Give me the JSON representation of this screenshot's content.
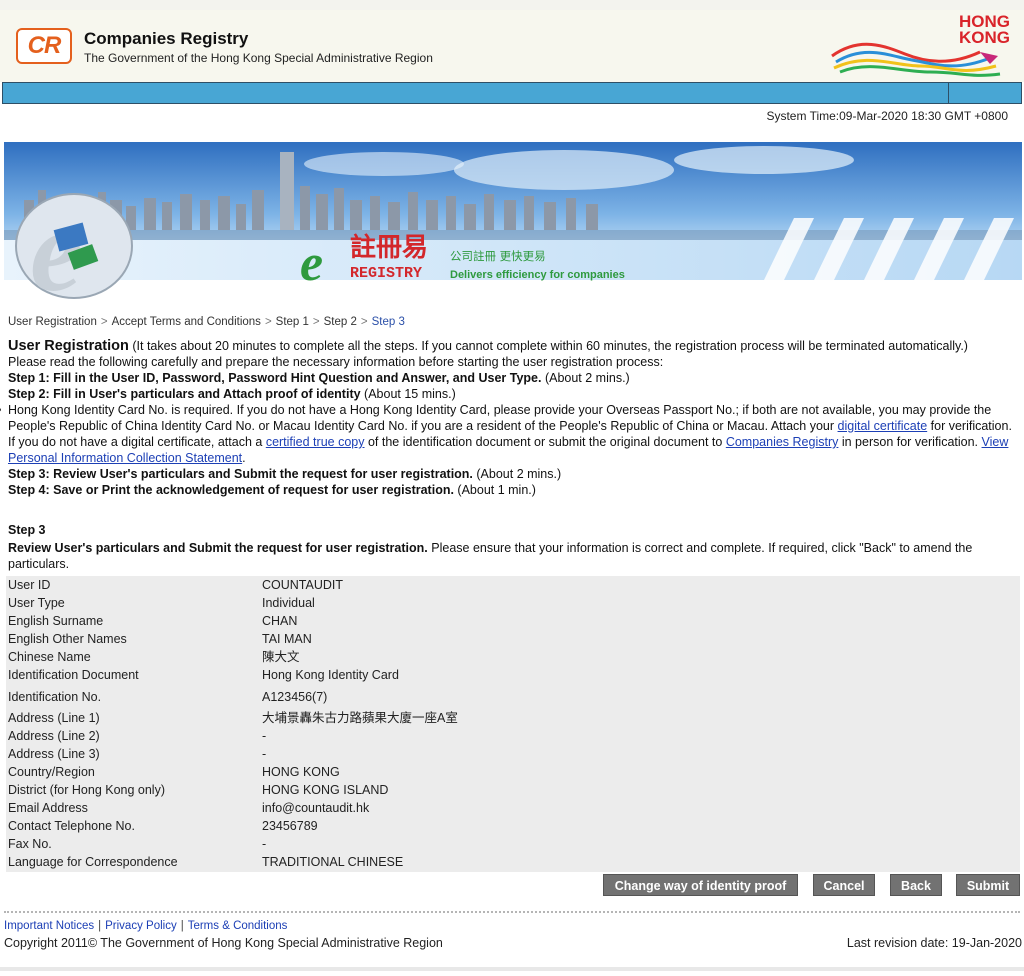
{
  "header": {
    "logo_text": "CR",
    "org_title": "Companies Registry",
    "org_subtitle": "The Government of the Hong Kong Special Administrative Region",
    "hk_brand_line1": "HONG",
    "hk_brand_line2": "KONG"
  },
  "system_time": "System Time:09-Mar-2020 18:30 GMT +0800",
  "banner": {
    "chinese_title": "註冊易",
    "english_title": "REGISTRY",
    "slogan_cn": "公司註冊 更快更易",
    "slogan_en": "Delivers efficiency for companies"
  },
  "breadcrumb": {
    "items": [
      "User Registration",
      "Accept Terms and Conditions",
      "Step 1",
      "Step 2"
    ],
    "current": "Step 3",
    "separator": ">"
  },
  "intro": {
    "title": "User Registration",
    "title_note": "(It takes about 20 minutes to complete all the steps. If you cannot complete within 60 minutes, the registration process will be terminated automatically.)",
    "read_carefully": "Please read the following carefully and prepare the necessary information before starting the user registration process:",
    "step1_bold": "Step 1: Fill in the User ID, Password, Password Hint Question and Answer, and User Type.",
    "step1_time": "(About 2 mins.)",
    "step2_bold": "Step 2: Fill in User's particulars and Attach proof of identity",
    "step2_time": "(About 15 mins.)",
    "bullet_part1": "Hong Kong Identity Card No. is required. If you do not have a Hong Kong Identity Card, please provide your Overseas Passport No.; if both are not available, you may provide the People's Republic of China Identity Card No. or Macau Identity Card No. if you are a resident of the People's Republic of China or Macau. Attach your",
    "link_digital_certificate": "digital certificate",
    "bullet_part2": "for verification. If you do not have a digital certificate, attach a",
    "link_certified_copy": "certified true copy",
    "bullet_part3": "of the identification document or submit the original document to",
    "link_companies_registry": "Companies Registry",
    "bullet_part4": "in person for verification.",
    "link_pics": "View Personal Information Collection Statement",
    "bullet_end": ".",
    "step3_bold": "Step 3: Review User's particulars and Submit the request for user registration.",
    "step3_time": "(About 2 mins.)",
    "step4_bold": "Step 4: Save or Print the acknowledgement of request for user registration.",
    "step4_time": "(About 1 min.)"
  },
  "step3": {
    "heading": "Step 3",
    "desc_bold": "Review User's particulars and Submit the request for user registration.",
    "desc_rest": "Please ensure that your information is correct and complete. If required, click \"Back\" to amend the particulars."
  },
  "details": [
    {
      "label": "User ID",
      "value": "COUNTAUDIT"
    },
    {
      "label": "User Type",
      "value": "Individual"
    },
    {
      "label": "English Surname",
      "value": "CHAN"
    },
    {
      "label": "English Other Names",
      "value": "TAI MAN"
    },
    {
      "label": "Chinese Name",
      "value": "陳大文"
    },
    {
      "label": "Identification Document",
      "value": "Hong Kong Identity Card"
    },
    {
      "label": "Identification No.",
      "value": "A123456(7)"
    },
    {
      "label": "Address (Line 1)",
      "value": "大埔景轟朱古力路蘋果大廈一座A室"
    },
    {
      "label": "Address (Line 2)",
      "value": "-"
    },
    {
      "label": "Address (Line 3)",
      "value": "-"
    },
    {
      "label": "Country/Region",
      "value": "HONG KONG"
    },
    {
      "label": "District (for Hong Kong only)",
      "value": "HONG KONG ISLAND"
    },
    {
      "label": "Email Address",
      "value": "info@countaudit.hk"
    },
    {
      "label": "Contact Telephone No.",
      "value": "23456789"
    },
    {
      "label": "Fax No.",
      "value": "-"
    },
    {
      "label": "Language for Correspondence",
      "value": "TRADITIONAL CHINESE"
    }
  ],
  "buttons": {
    "change_identity": "Change way of identity proof",
    "cancel": "Cancel",
    "back": "Back",
    "submit": "Submit"
  },
  "footer": {
    "important_notices": "Important Notices",
    "privacy_policy": "Privacy Policy",
    "terms": "Terms & Conditions",
    "link_separator": "|",
    "copyright": "Copyright 2011© The Government of Hong Kong Special Administrative Region",
    "revision": "Last revision date: 19-Jan-2020"
  },
  "colors": {
    "navbar": "#48a6d4",
    "cr_orange": "#e4601d",
    "hk_red": "#d9242a",
    "link_blue": "#1c3fb5",
    "button_gray": "#727272",
    "table_bg": "#ececec"
  }
}
